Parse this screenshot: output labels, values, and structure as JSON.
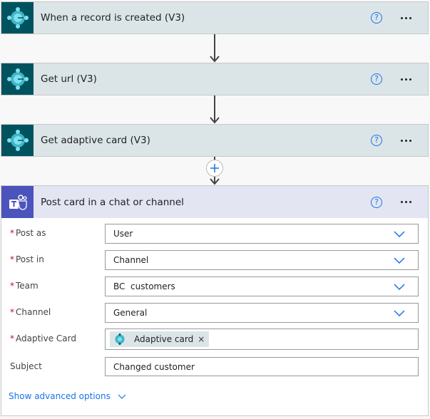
{
  "steps": [
    {
      "title": "When a record is created (V3)",
      "icon": "business-central-icon"
    },
    {
      "title": "Get url (V3)",
      "icon": "business-central-icon"
    },
    {
      "title": "Get adaptive card (V3)",
      "icon": "business-central-icon"
    }
  ],
  "help_glyph": "?",
  "action": {
    "title": "Post card in a chat or channel",
    "icon": "teams-icon",
    "fields": [
      {
        "label": "Post as",
        "required": true,
        "value": "User",
        "type": "dropdown"
      },
      {
        "label": "Post in",
        "required": true,
        "value": "Channel",
        "type": "dropdown"
      },
      {
        "label": "Team",
        "required": true,
        "value": "BC  customers",
        "type": "dropdown"
      },
      {
        "label": "Channel",
        "required": true,
        "value": "General",
        "type": "dropdown"
      },
      {
        "label": "Adaptive Card",
        "required": true,
        "value": "",
        "token": "Adaptive card",
        "type": "token"
      },
      {
        "label": "Subject",
        "required": false,
        "value": "Changed customer",
        "type": "text"
      }
    ],
    "advanced_label": "Show advanced options"
  },
  "required_marker": "*",
  "token_remove_glyph": "×",
  "colors": {
    "accent": "#1a73e8",
    "bc_header": "#dbe5e7",
    "bc_icon_bg": "#00535e",
    "teams_header": "#e4e5f3",
    "teams_icon_bg": "#4b53bc"
  }
}
